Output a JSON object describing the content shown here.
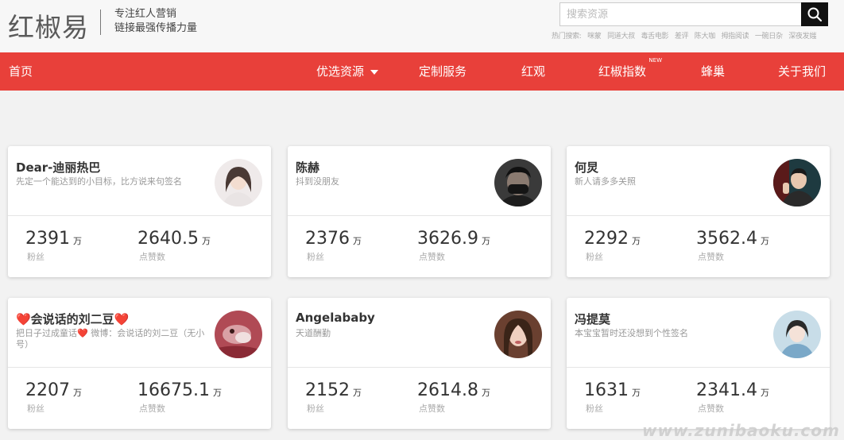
{
  "header": {
    "logo": "红椒易",
    "slogan_line1": "专注红人营销",
    "slogan_line2": "链接最强传播力量",
    "search_placeholder": "搜索资源",
    "hot_label": "热门搜索:",
    "hot_terms": [
      "咪蒙",
      "同道大叔",
      "毒舌电影",
      "差评",
      "陈大咖",
      "拇指阅读",
      "一碗日杂",
      "深夜发媸"
    ]
  },
  "nav": {
    "home": "首页",
    "resources": "优选资源",
    "custom": "定制服务",
    "hongguan": "红观",
    "index": "红椒指数",
    "index_badge": "NEW",
    "hive": "蜂巢",
    "about": "关于我们"
  },
  "stat_labels": {
    "fans": "粉丝",
    "likes": "点赞数",
    "unit": "万"
  },
  "cards": [
    {
      "name": "Dear-迪丽热巴",
      "signature": "先定一个能达到的小目标，比方说来句签名",
      "fans": "2391",
      "likes": "2640.5",
      "avatar_color": "#d9cfc9"
    },
    {
      "name": "陈赫",
      "signature": "抖到没朋友",
      "fans": "2376",
      "likes": "3626.9",
      "avatar_color": "#2a2a2a"
    },
    {
      "name": "何炅",
      "signature": "新人请多多关照",
      "fans": "2292",
      "likes": "3562.4",
      "avatar_color": "#7a2a25"
    },
    {
      "name": "❤️会说话的刘二豆❤️",
      "signature": "把日子过成童话❤️ 微博：会说话的刘二豆（无小号）",
      "fans": "2207",
      "likes": "16675.1",
      "avatar_color": "#b0505a"
    },
    {
      "name": "Angelababy",
      "signature": "天道酬勤",
      "fans": "2152",
      "likes": "2614.8",
      "avatar_color": "#8a5a45"
    },
    {
      "name": "冯提莫",
      "signature": "本宝宝暂时还没想到个性签名",
      "fans": "1631",
      "likes": "2341.4",
      "avatar_color": "#6a8aa0"
    }
  ],
  "watermark": "www.zunibaoku.com"
}
